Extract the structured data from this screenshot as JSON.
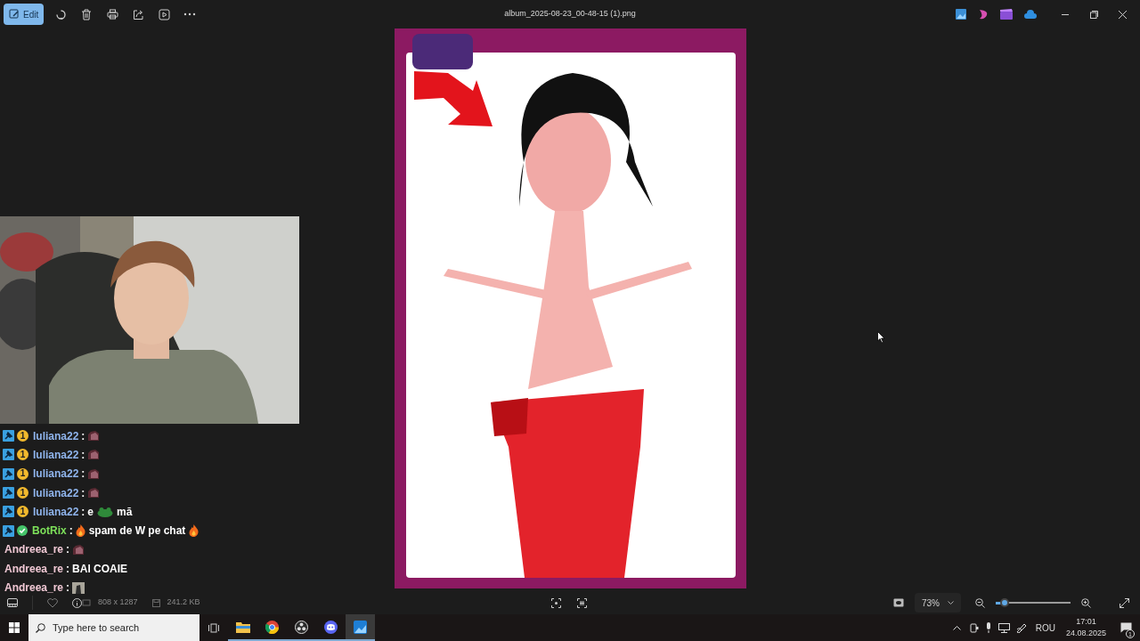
{
  "toolbar": {
    "edit_button": {
      "label": "Edit",
      "selected": true
    },
    "title": "album_2025-08-23_00-48-15 (1).png"
  },
  "chat": [
    {
      "name": "Iuliana22",
      "color": "#8fb4ec",
      "separator": ":",
      "badges": [
        {
          "kind": "tool"
        },
        {
          "kind": "coin",
          "text": "1"
        }
      ],
      "parts": [
        {
          "kind": "emote"
        }
      ]
    },
    {
      "name": "Iuliana22",
      "color": "#8fb4ec",
      "separator": ":",
      "badges": [
        {
          "kind": "tool"
        },
        {
          "kind": "coin",
          "text": "1"
        }
      ],
      "parts": [
        {
          "kind": "emote"
        }
      ]
    },
    {
      "name": "Iuliana22",
      "color": "#8fb4ec",
      "separator": ":",
      "badges": [
        {
          "kind": "tool"
        },
        {
          "kind": "coin",
          "text": "1"
        }
      ],
      "parts": [
        {
          "kind": "emote"
        }
      ]
    },
    {
      "name": "Iuliana22",
      "color": "#8fb4ec",
      "separator": ":",
      "badges": [
        {
          "kind": "tool"
        },
        {
          "kind": "coin",
          "text": "1"
        }
      ],
      "parts": [
        {
          "kind": "emote"
        }
      ]
    },
    {
      "name": "Iuliana22",
      "color": "#8fb4ec",
      "separator": ":",
      "badges": [
        {
          "kind": "tool"
        },
        {
          "kind": "coin",
          "text": "1"
        }
      ],
      "parts": [
        {
          "kind": "text",
          "text": "e"
        },
        {
          "kind": "frog"
        },
        {
          "kind": "text",
          "text": "mă"
        }
      ]
    },
    {
      "name": "BotRix",
      "color": "#7de05a",
      "separator": ":",
      "badges": [
        {
          "kind": "tool"
        },
        {
          "kind": "verified"
        }
      ],
      "parts": [
        {
          "kind": "fire"
        },
        {
          "kind": "text",
          "text": "spam de W pe chat"
        },
        {
          "kind": "fire"
        }
      ]
    },
    {
      "name": "Andreea_re",
      "color": "#f0c8d4",
      "separator": ":",
      "parts": [
        {
          "kind": "emote"
        }
      ]
    },
    {
      "name": "Andreea_re",
      "color": "#f0c8d4",
      "separator": ":",
      "parts": [
        {
          "kind": "text",
          "text": "BAI COAIE"
        }
      ]
    },
    {
      "name": "Andreea_re",
      "color": "#f0c8d4",
      "separator": ":",
      "parts": [
        {
          "kind": "sticker"
        }
      ]
    }
  ],
  "info_bar": {
    "dimensions": "808 x 1287",
    "file_size": "241.2 KB",
    "zoom": "73%",
    "zoom_slider": {
      "level": 0.12
    }
  },
  "taskbar": {
    "search": {
      "placeholder": "Type here to search"
    },
    "language": "ROU",
    "time": "17:01",
    "date": "24.08.2025",
    "notifications": "1"
  }
}
